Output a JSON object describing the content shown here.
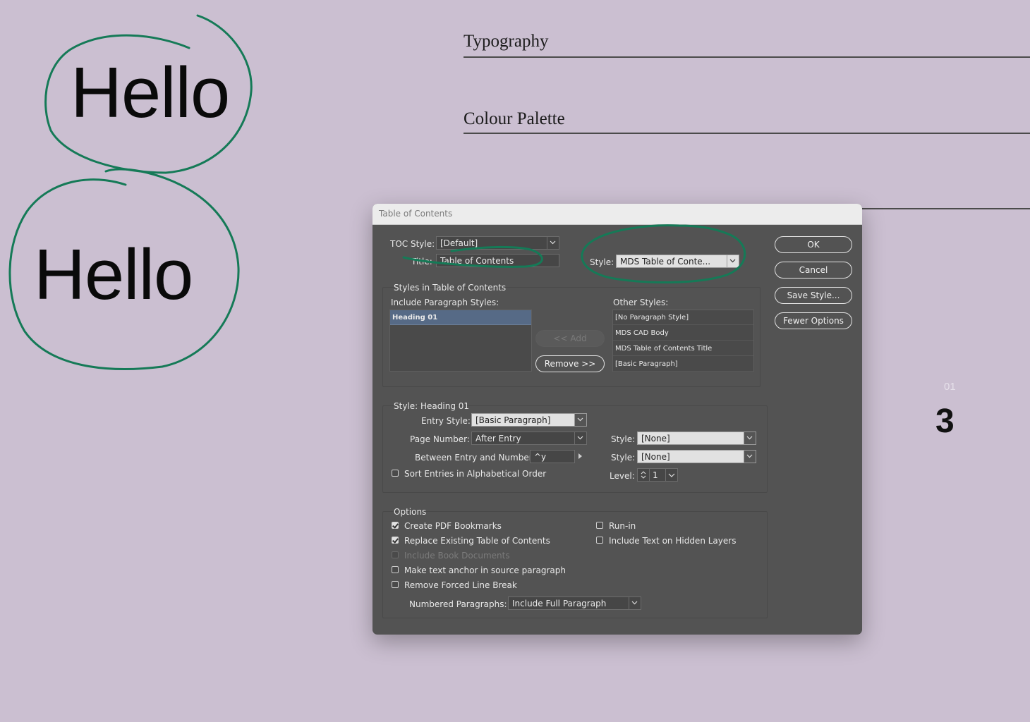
{
  "canvas": {
    "hello_top": "Hello",
    "hello_bottom": "Hello",
    "section_typography": "Typography",
    "section_colour": "Colour Palette",
    "page_folio_small": "01",
    "page_number": "3"
  },
  "dialog": {
    "title": "Table of Contents",
    "toc_style_label": "TOC Style:",
    "toc_style_value": "[Default]",
    "title_label": "Title:",
    "title_value": "Table of Contents",
    "style_label": "Style:",
    "style_value": "MDS Table of Conte...",
    "buttons": {
      "ok": "OK",
      "cancel": "Cancel",
      "save_style": "Save Style...",
      "fewer_options": "Fewer Options",
      "add": "<< Add",
      "remove": "Remove >>"
    },
    "styles_group": {
      "heading": "Styles in Table of Contents",
      "include_label": "Include Paragraph Styles:",
      "included": [
        "Heading 01"
      ],
      "other_label": "Other Styles:",
      "other": [
        "[No Paragraph Style]",
        "MDS CAD Body",
        "MDS Table of Contents Title",
        "[Basic Paragraph]"
      ]
    },
    "style_group": {
      "heading": "Style: Heading 01",
      "entry_style_label": "Entry Style:",
      "entry_style_value": "[Basic Paragraph]",
      "page_number_label": "Page Number:",
      "page_number_value": "After Entry",
      "page_number_style_label": "Style:",
      "page_number_style_value": "[None]",
      "between_label": "Between Entry and Number:",
      "between_value": "^y",
      "between_style_label": "Style:",
      "between_style_value": "[None]",
      "sort_label": "Sort Entries in Alphabetical Order",
      "sort_checked": false,
      "level_label": "Level:",
      "level_value": "1"
    },
    "options_group": {
      "heading": "Options",
      "create_pdf": "Create PDF Bookmarks",
      "create_pdf_checked": true,
      "replace_existing": "Replace Existing Table of Contents",
      "replace_existing_checked": true,
      "include_book": "Include Book Documents",
      "include_book_enabled": false,
      "make_anchor": "Make text anchor in source paragraph",
      "make_anchor_checked": false,
      "remove_break": "Remove Forced Line Break",
      "remove_break_checked": false,
      "run_in": "Run-in",
      "run_in_checked": false,
      "hidden_layers": "Include Text on Hidden Layers",
      "hidden_layers_checked": false,
      "numbered_label": "Numbered Paragraphs:",
      "numbered_value": "Include Full Paragraph"
    }
  },
  "colors": {
    "page_background": "#cbbfd1",
    "dialog_background": "#535353",
    "annotation_green": "#157a57",
    "selection": "#566a86"
  }
}
